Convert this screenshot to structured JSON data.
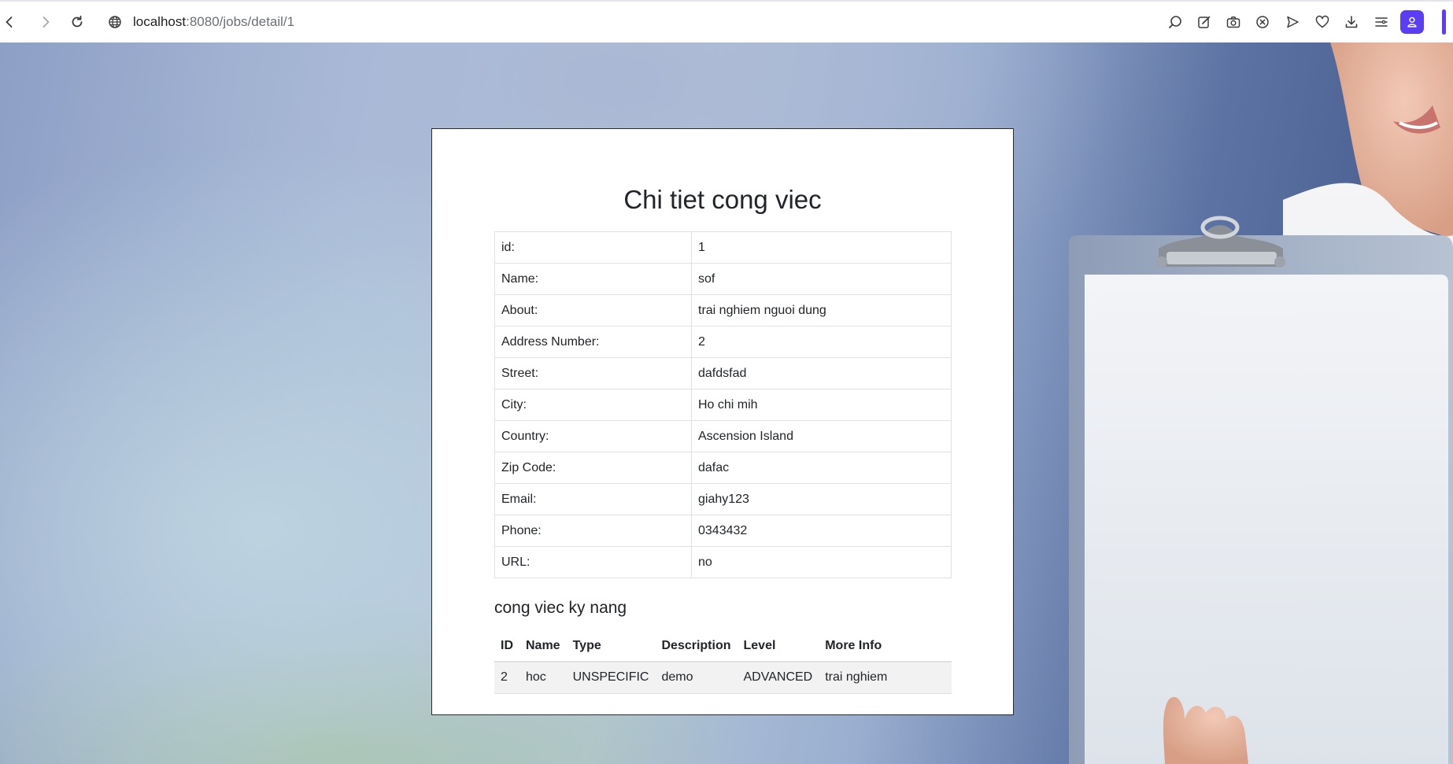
{
  "browser": {
    "url_host": "localhost",
    "url_path": ":8080/jobs/detail/1",
    "accent_color": "#5b3ef4"
  },
  "card": {
    "title": "Chi tiet cong viec",
    "details": [
      {
        "label": "id:",
        "value": "1"
      },
      {
        "label": "Name:",
        "value": "sof"
      },
      {
        "label": "About:",
        "value": "trai nghiem nguoi dung"
      },
      {
        "label": "Address Number:",
        "value": "2"
      },
      {
        "label": "Street:",
        "value": "dafdsfad"
      },
      {
        "label": "City:",
        "value": "Ho chi mih"
      },
      {
        "label": "Country:",
        "value": "Ascension Island"
      },
      {
        "label": "Zip Code:",
        "value": "dafac"
      },
      {
        "label": "Email:",
        "value": "giahy123"
      },
      {
        "label": "Phone:",
        "value": "0343432"
      },
      {
        "label": "URL:",
        "value": "no"
      }
    ],
    "skills_title": "cong viec ky nang",
    "skills_headers": [
      "ID",
      "Name",
      "Type",
      "Description",
      "Level",
      "More Info"
    ],
    "skills_rows": [
      [
        "2",
        "hoc",
        "UNSPECIFIC",
        "demo",
        "ADVANCED",
        "trai nghiem"
      ]
    ]
  }
}
